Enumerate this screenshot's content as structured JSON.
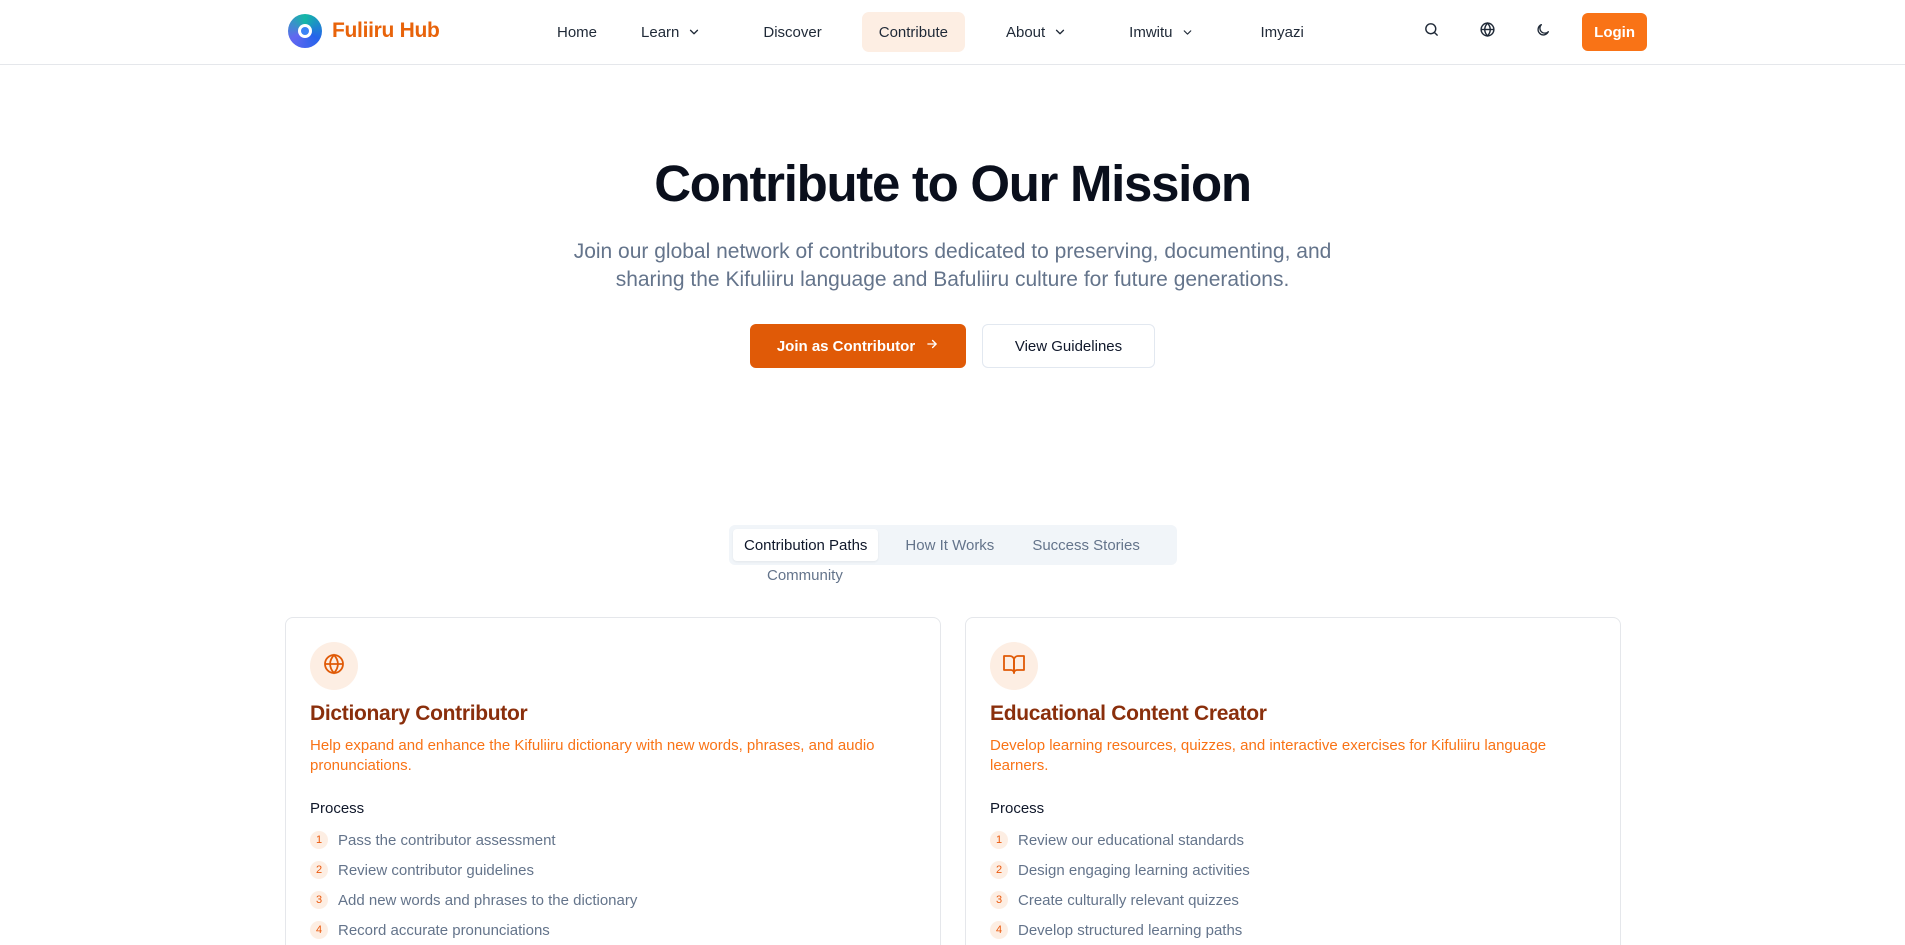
{
  "brand": {
    "name": "Fuliiru Hub"
  },
  "nav": {
    "home": "Home",
    "learn": "Learn",
    "discover": "Discover",
    "contribute": "Contribute",
    "about": "About",
    "imwitu": "Imwitu",
    "imyazi": "Imyazi"
  },
  "header": {
    "login": "Login",
    "icons": [
      "search-icon",
      "globe-icon",
      "moon-icon"
    ]
  },
  "hero": {
    "title": "Contribute to Our Mission",
    "subtitle": "Join our global network of contributors dedicated to preserving, documenting, and sharing the Kifuliiru language and Bafuliiru culture for future generations.",
    "primary_button": "Join as Contributor",
    "secondary_button": "View Guidelines"
  },
  "tabs": {
    "items": [
      "Contribution Paths",
      "How It Works",
      "Success Stories",
      "Community"
    ],
    "active": "Contribution Paths"
  },
  "cards": [
    {
      "icon": "globe-icon",
      "title": "Dictionary Contributor",
      "description": "Help expand and enhance the Kifuliiru dictionary with new words, phrases, and audio pronunciations.",
      "process_label": "Process",
      "steps": [
        "Pass the contributor assessment",
        "Review contributor guidelines",
        "Add new words and phrases to the dictionary",
        "Record accurate pronunciations"
      ]
    },
    {
      "icon": "book-open-icon",
      "title": "Educational Content Creator",
      "description": "Develop learning resources, quizzes, and interactive exercises for Kifuliiru language learners.",
      "process_label": "Process",
      "steps": [
        "Review our educational standards",
        "Design engaging learning activities",
        "Create culturally relevant quizzes",
        "Develop structured learning paths"
      ]
    }
  ],
  "colors": {
    "brand": "#e8630a",
    "accent": "#f97316",
    "primary_button": "#e05a07",
    "card_title": "#8a2f0c",
    "tint": "#fdeee3"
  }
}
